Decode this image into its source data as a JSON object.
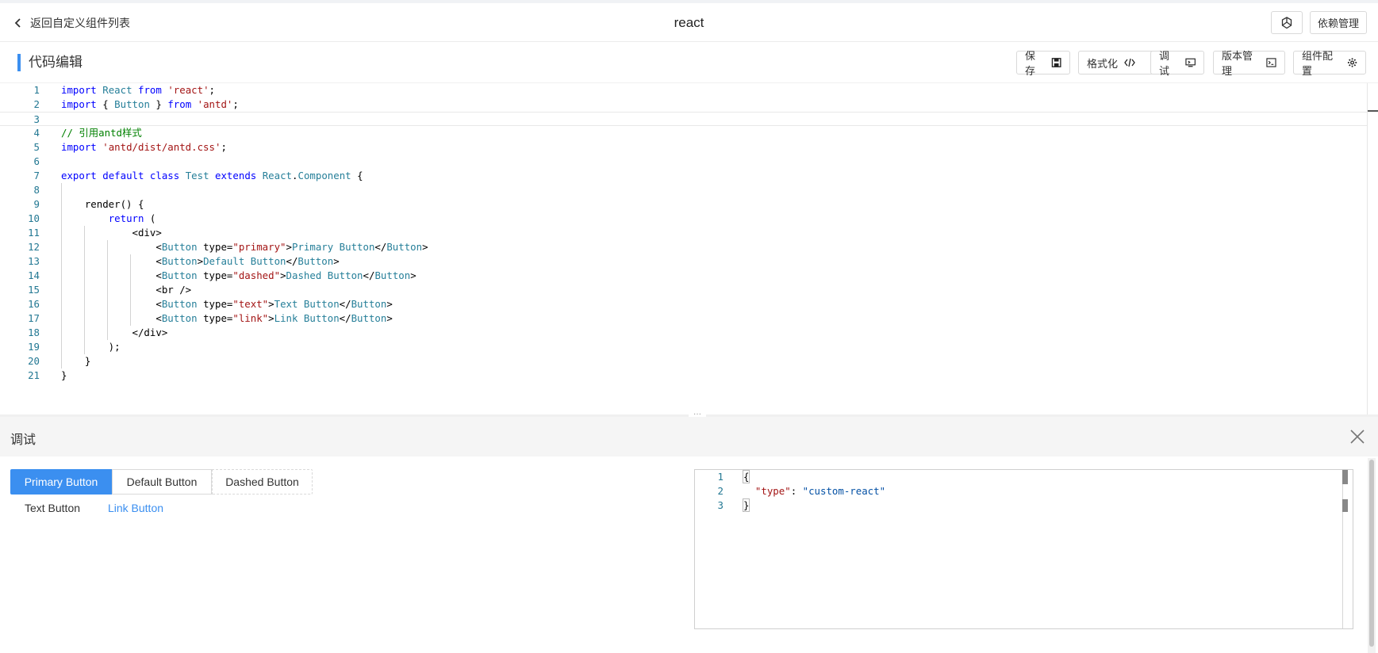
{
  "header": {
    "back_label": "返回自定义组件列表",
    "title": "react",
    "icon_button": "openai-icon",
    "dependency_label": "依赖管理"
  },
  "toolbar": {
    "section_title": "代码编辑",
    "save_label": "保存",
    "format_label": "格式化",
    "debug_label": "调试",
    "version_label": "版本管理",
    "config_label": "组件配置"
  },
  "editor": {
    "lines": [
      "import React from 'react';",
      "import { Button } from 'antd';",
      "",
      "// 引用antd样式",
      "import 'antd/dist/antd.css';",
      "",
      "export default class Test extends React.Component {",
      "",
      "    render() {",
      "        return (",
      "            <div>",
      "                <Button type=\"primary\">Primary Button</Button>",
      "                <Button>Default Button</Button>",
      "                <Button type=\"dashed\">Dashed Button</Button>",
      "                <br />",
      "                <Button type=\"text\">Text Button</Button>",
      "                <Button type=\"link\">Link Button</Button>",
      "            </div>",
      "        );",
      "    }",
      "}"
    ],
    "current_line": 3
  },
  "debug": {
    "title": "调试",
    "preview": {
      "primary": "Primary Button",
      "default": "Default Button",
      "dashed": "Dashed Button",
      "text": "Text Button",
      "link": "Link Button"
    },
    "json_lines": [
      "{",
      "  \"type\": \"custom-react\"",
      "}"
    ]
  },
  "colors": {
    "accent": "#3b8ff0",
    "keyword": "#0000ff",
    "type": "#267f99",
    "string": "#a31515",
    "comment": "#008000",
    "line_number": "#237893"
  }
}
